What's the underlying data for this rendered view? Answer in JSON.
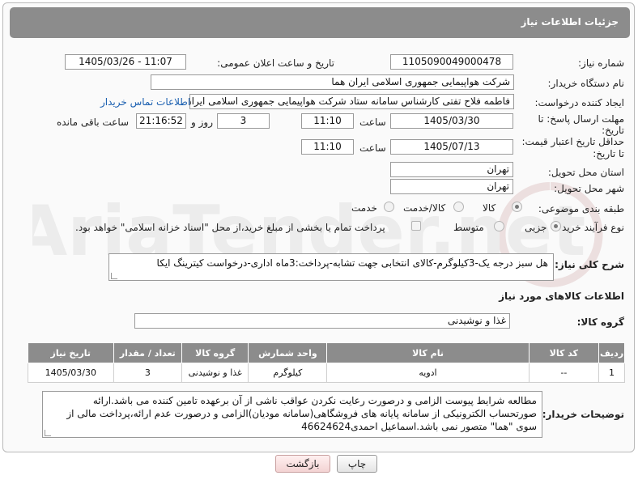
{
  "header": {
    "title": "جزئیات اطلاعات نیاز"
  },
  "form": {
    "need_number_label": "شماره نیاز:",
    "need_number": "1105090049000478",
    "announce_label": "تاریخ و ساعت اعلان عمومی:",
    "announce_value": "1405/03/26 - 11:07",
    "buyer_org_label": "نام دستگاه خریدار:",
    "buyer_org": "شرکت هواپیمایی جمهوری اسلامی ایران هما",
    "creator_label": "ایجاد کننده درخواست:",
    "creator": "فاطمه فلاح تفتی کارشناس سامانه ستاد شرکت هواپیمایی جمهوری اسلامی ایران هما",
    "contact_link": "اطلاعات تماس خریدار",
    "reply_deadline_label_1": "مهلت ارسال پاسخ: تا",
    "reply_deadline_label_2": "تاریخ:",
    "reply_date": "1405/03/30",
    "time_label": "ساعت",
    "reply_time": "11:10",
    "days_value": "3",
    "days_label": "روز و",
    "remaining_time": "21:16:52",
    "remaining_label": "ساعت باقی مانده",
    "price_validity_label_1": "حداقل تاریخ اعتبار قیمت:",
    "price_validity_label_2": "تا تاریخ:",
    "price_date": "1405/07/13",
    "price_time": "11:10",
    "province_label": "استان محل تحویل:",
    "province": "تهران",
    "city_label": "شهر محل تحویل:",
    "city": "تهران",
    "category_label": "طبقه بندی موضوعی:",
    "category_options": [
      "کالا",
      "کالا/خدمت",
      "خدمت"
    ],
    "category_selected": "کالا",
    "process_label": "نوع فرآیند خرید :",
    "process_options": [
      "جزیی",
      "متوسط"
    ],
    "process_selected": "جزیی",
    "payment_note": "پرداخت تمام یا بخشی از مبلغ خرید،از محل \"اسناد خزانه اسلامی\" خواهد بود."
  },
  "summary": {
    "label": "شرح کلی نیاز:",
    "text": "هل سبز درجه یک-3کیلوگرم-کالای انتخابی جهت تشابه-پرداخت:3ماه اداری-درخواست کیترینگ ایکا"
  },
  "goods": {
    "section_title": "اطلاعات کالاهای مورد نیاز",
    "group_label": "گروه کالا:",
    "group_value": "غذا و نوشیدنی",
    "columns": [
      "ردیف",
      "کد کالا",
      "نام کالا",
      "واحد شمارش",
      "گروه کالا",
      "تعداد / مقدار",
      "تاریخ نیاز"
    ],
    "rows": [
      [
        "1",
        "--",
        "ادویه",
        "کیلوگرم",
        "غذا و نوشیدنی",
        "3",
        "1405/03/30"
      ]
    ]
  },
  "buyer_notes": {
    "label": "توضیحات خریدار:",
    "text": "مطالعه شرایط پیوست الزامی و درصورت رعایت نکردن عواقب ناشی از آن برعهده تامین کننده می باشد.ارائه صورتحساب الکترونیکی از سامانه پایانه های فروشگاهی(سامانه مودیان)الزامی و درصورت عدم ارائه،پرداخت مالی از سوی \"هما\" متصور نمی باشد.اسماعیل احمدی46624624"
  },
  "buttons": {
    "print": "چاپ",
    "back": "بازگشت"
  },
  "colors": {
    "header_bg": "#8c8c8c",
    "link": "#1a5fb0",
    "back_button": "#f3d3d3"
  }
}
